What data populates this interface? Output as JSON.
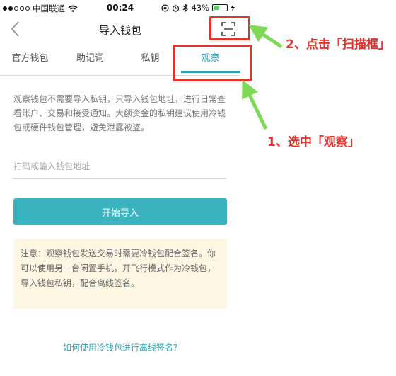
{
  "status_bar": {
    "carrier": "中国联通",
    "time": "00:24",
    "battery_percent": "43%",
    "battery_level": 0.43,
    "signal_bars_on": 2,
    "signal_bars_total": 5
  },
  "header": {
    "title": "导入钱包",
    "back_icon": "chevron-left-icon",
    "scan_icon": "scan-frame-icon"
  },
  "tabs": [
    {
      "label": "官方钱包"
    },
    {
      "label": "助记词"
    },
    {
      "label": "私钥"
    },
    {
      "label": "观察",
      "active": true
    }
  ],
  "description": "观察钱包不需要导入私钥，只导入钱包地址，进行日常查看账户、交易和接受通知。大额资金的私钥建议使用冷钱包或硬件钱包管理，避免泄露被盗。",
  "address_input": {
    "value": "",
    "placeholder": "扫码或输入钱包地址"
  },
  "start_button": "开始导入",
  "note": "注意：观察钱包发送交易时需要冷钱包配合签名。你可以使用另一台闲置手机，开飞行模式作为冷钱包，导入钱包私钥，配合离线签名。",
  "help_link": "如何使用冷钱包进行离线签名?",
  "annotations": {
    "step2": "2、点击「扫描框」",
    "step1": "1、选中「观察」",
    "color": "#e5322b",
    "arrow_color": "#7ed957"
  },
  "colors": {
    "accent": "#2aa3b3",
    "button": "#3ab3bf",
    "note_bg": "#fdf6e3"
  }
}
